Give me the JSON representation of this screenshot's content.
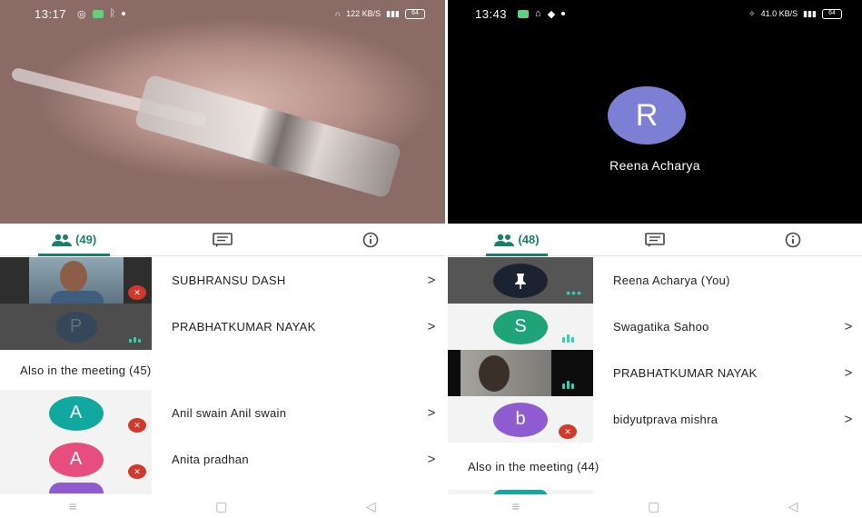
{
  "left_phone": {
    "status": {
      "time": "13:17",
      "net": "122 KB/S",
      "battery": "64"
    },
    "tabs": {
      "people_count": "(49)"
    },
    "rows": [
      {
        "name": "SUBHRANSU DASH"
      },
      {
        "name": "PRABHATKUMAR NAYAK",
        "initial": "P"
      }
    ],
    "section_title": "Also in the meeting (45)",
    "more_rows": [
      {
        "name": "Anil swain Anil swain",
        "initial": "A"
      },
      {
        "name": "Anita pradhan",
        "initial": "A"
      }
    ]
  },
  "right_phone": {
    "status": {
      "time": "13:43",
      "net": "41.0 KB/S",
      "battery": "64"
    },
    "speaker": {
      "initial": "R",
      "name": "Reena Acharya"
    },
    "tabs": {
      "people_count": "(48)"
    },
    "rows": [
      {
        "name": "Reena Acharya (You)"
      },
      {
        "name": "Swagatika Sahoo",
        "initial": "S"
      },
      {
        "name": "PRABHATKUMAR NAYAK"
      },
      {
        "name": "bidyutprava mishra",
        "initial": "b"
      }
    ],
    "section_title": "Also in the meeting (44)"
  },
  "chevron": ">",
  "colors": {
    "accent": "#1a7f69",
    "teal": "#11a8a0",
    "pink": "#e74d7e",
    "purple": "#8e5bd0",
    "green": "#1fa47a",
    "periwinkle": "#7d7fd4",
    "mute_red": "#d0392b"
  }
}
